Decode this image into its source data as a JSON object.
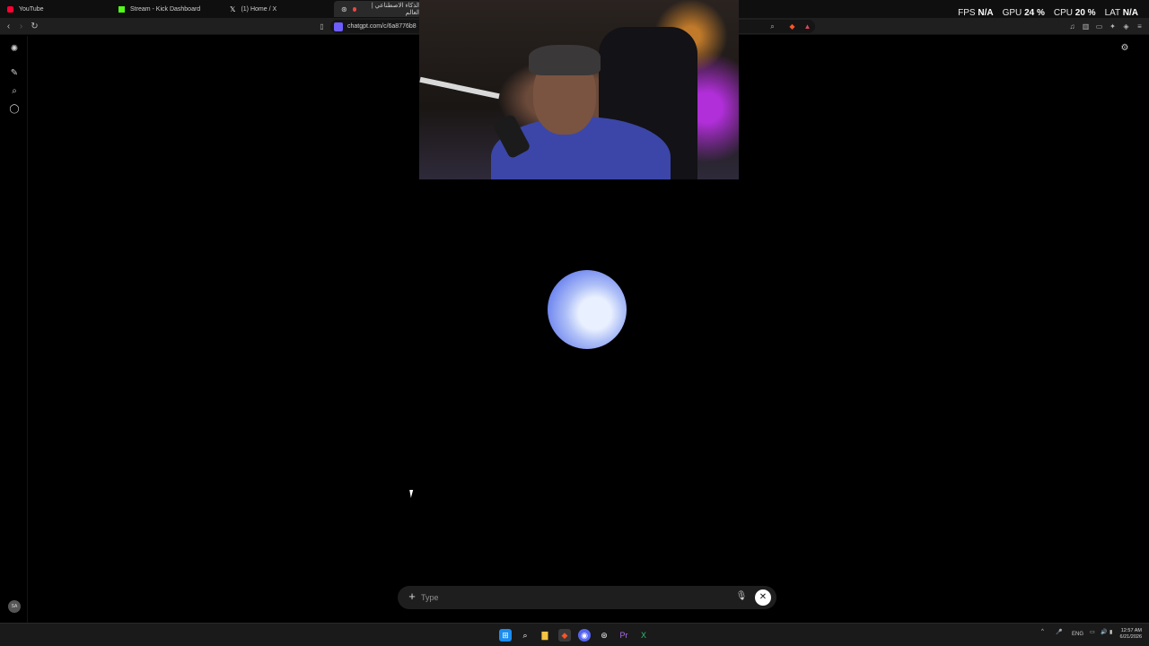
{
  "browser": {
    "tabs": [
      {
        "label": "YouTube",
        "icon": "youtube-icon",
        "color": "#ff0033"
      },
      {
        "label": "Stream - Kick Dashboard",
        "icon": "kick-icon",
        "color": "#53fc18"
      },
      {
        "label": "(1) Home / X",
        "icon": "x-icon",
        "color": "#ffffff"
      },
      {
        "label": "الذكاء الاصطناعي | العالم",
        "icon": "chatgpt-icon",
        "color": "#cfcfcf"
      }
    ],
    "url": "chatgpt.com/c/6a8776b8"
  },
  "hud": {
    "fps_label": "FPS",
    "fps_value": "N/A",
    "gpu_label": "GPU",
    "gpu_value": "24 %",
    "cpu_label": "CPU",
    "cpu_value": "20 %",
    "lat_label": "LAT",
    "lat_value": "N/A"
  },
  "sidebar": {
    "icons": [
      "openai-logo-icon",
      "new-chat-icon",
      "search-icon",
      "chat-icon"
    ],
    "avatar_initials": "SA"
  },
  "composer": {
    "placeholder": "Type"
  },
  "taskbar": {
    "lang": "ENG",
    "time": "12:57 AM",
    "date": "6/21/2026"
  },
  "colors": {
    "background": "#000000",
    "orb": "#aebff7",
    "composer_bg": "#1e1e1e"
  }
}
